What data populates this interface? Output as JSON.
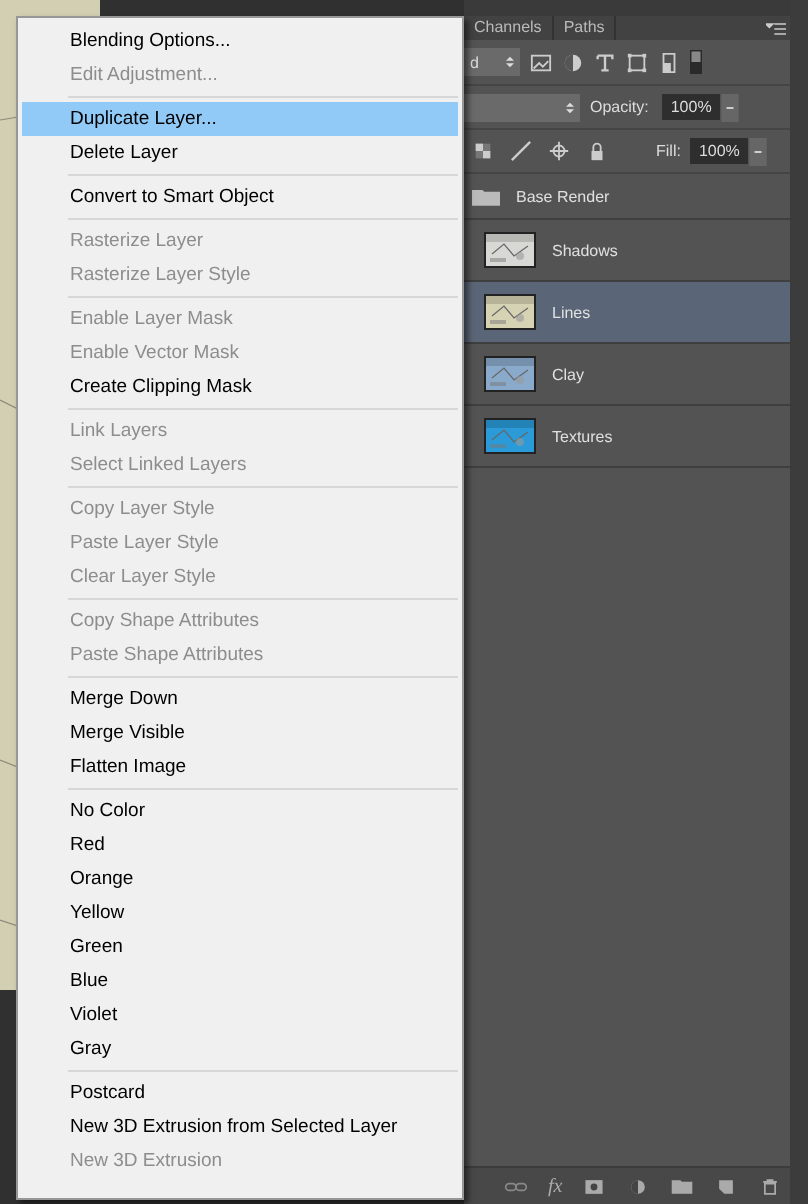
{
  "panel": {
    "tabs": [
      {
        "label": "Channels",
        "selected": false
      },
      {
        "label": "Paths",
        "selected": false
      }
    ],
    "filter_kind": "d",
    "opacity": {
      "label": "Opacity:",
      "value": "100%"
    },
    "fill": {
      "label": "Fill:",
      "value": "100%"
    },
    "layers": [
      {
        "name": "Base Render",
        "kind": "group",
        "selected": false
      },
      {
        "name": "Shadows",
        "kind": "layer",
        "selected": false
      },
      {
        "name": "Lines",
        "kind": "layer",
        "selected": true
      },
      {
        "name": "Clay",
        "kind": "layer",
        "selected": false
      },
      {
        "name": "Textures",
        "kind": "layer",
        "selected": false
      }
    ],
    "fx_label": "fx"
  },
  "context_menu": {
    "sections": [
      [
        {
          "label": "Blending Options...",
          "disabled": false,
          "selected": false
        },
        {
          "label": "Edit Adjustment...",
          "disabled": true,
          "selected": false
        }
      ],
      [
        {
          "label": "Duplicate Layer...",
          "disabled": false,
          "selected": true
        },
        {
          "label": "Delete Layer",
          "disabled": false,
          "selected": false
        }
      ],
      [
        {
          "label": "Convert to Smart Object",
          "disabled": false,
          "selected": false
        }
      ],
      [
        {
          "label": "Rasterize Layer",
          "disabled": true,
          "selected": false
        },
        {
          "label": "Rasterize Layer Style",
          "disabled": true,
          "selected": false
        }
      ],
      [
        {
          "label": "Enable Layer Mask",
          "disabled": true,
          "selected": false
        },
        {
          "label": "Enable Vector Mask",
          "disabled": true,
          "selected": false
        },
        {
          "label": "Create Clipping Mask",
          "disabled": false,
          "selected": false
        }
      ],
      [
        {
          "label": "Link Layers",
          "disabled": true,
          "selected": false
        },
        {
          "label": "Select Linked Layers",
          "disabled": true,
          "selected": false
        }
      ],
      [
        {
          "label": "Copy Layer Style",
          "disabled": true,
          "selected": false
        },
        {
          "label": "Paste Layer Style",
          "disabled": true,
          "selected": false
        },
        {
          "label": "Clear Layer Style",
          "disabled": true,
          "selected": false
        }
      ],
      [
        {
          "label": "Copy Shape Attributes",
          "disabled": true,
          "selected": false
        },
        {
          "label": "Paste Shape Attributes",
          "disabled": true,
          "selected": false
        }
      ],
      [
        {
          "label": "Merge Down",
          "disabled": false,
          "selected": false
        },
        {
          "label": "Merge Visible",
          "disabled": false,
          "selected": false
        },
        {
          "label": "Flatten Image",
          "disabled": false,
          "selected": false
        }
      ],
      [
        {
          "label": "No Color",
          "disabled": false,
          "selected": false
        },
        {
          "label": "Red",
          "disabled": false,
          "selected": false
        },
        {
          "label": "Orange",
          "disabled": false,
          "selected": false
        },
        {
          "label": "Yellow",
          "disabled": false,
          "selected": false
        },
        {
          "label": "Green",
          "disabled": false,
          "selected": false
        },
        {
          "label": "Blue",
          "disabled": false,
          "selected": false
        },
        {
          "label": "Violet",
          "disabled": false,
          "selected": false
        },
        {
          "label": "Gray",
          "disabled": false,
          "selected": false
        }
      ],
      [
        {
          "label": "Postcard",
          "disabled": false,
          "selected": false
        },
        {
          "label": "New 3D Extrusion from Selected Layer",
          "disabled": false,
          "selected": false
        },
        {
          "label": "New 3D Extrusion",
          "disabled": true,
          "selected": false
        }
      ]
    ]
  }
}
